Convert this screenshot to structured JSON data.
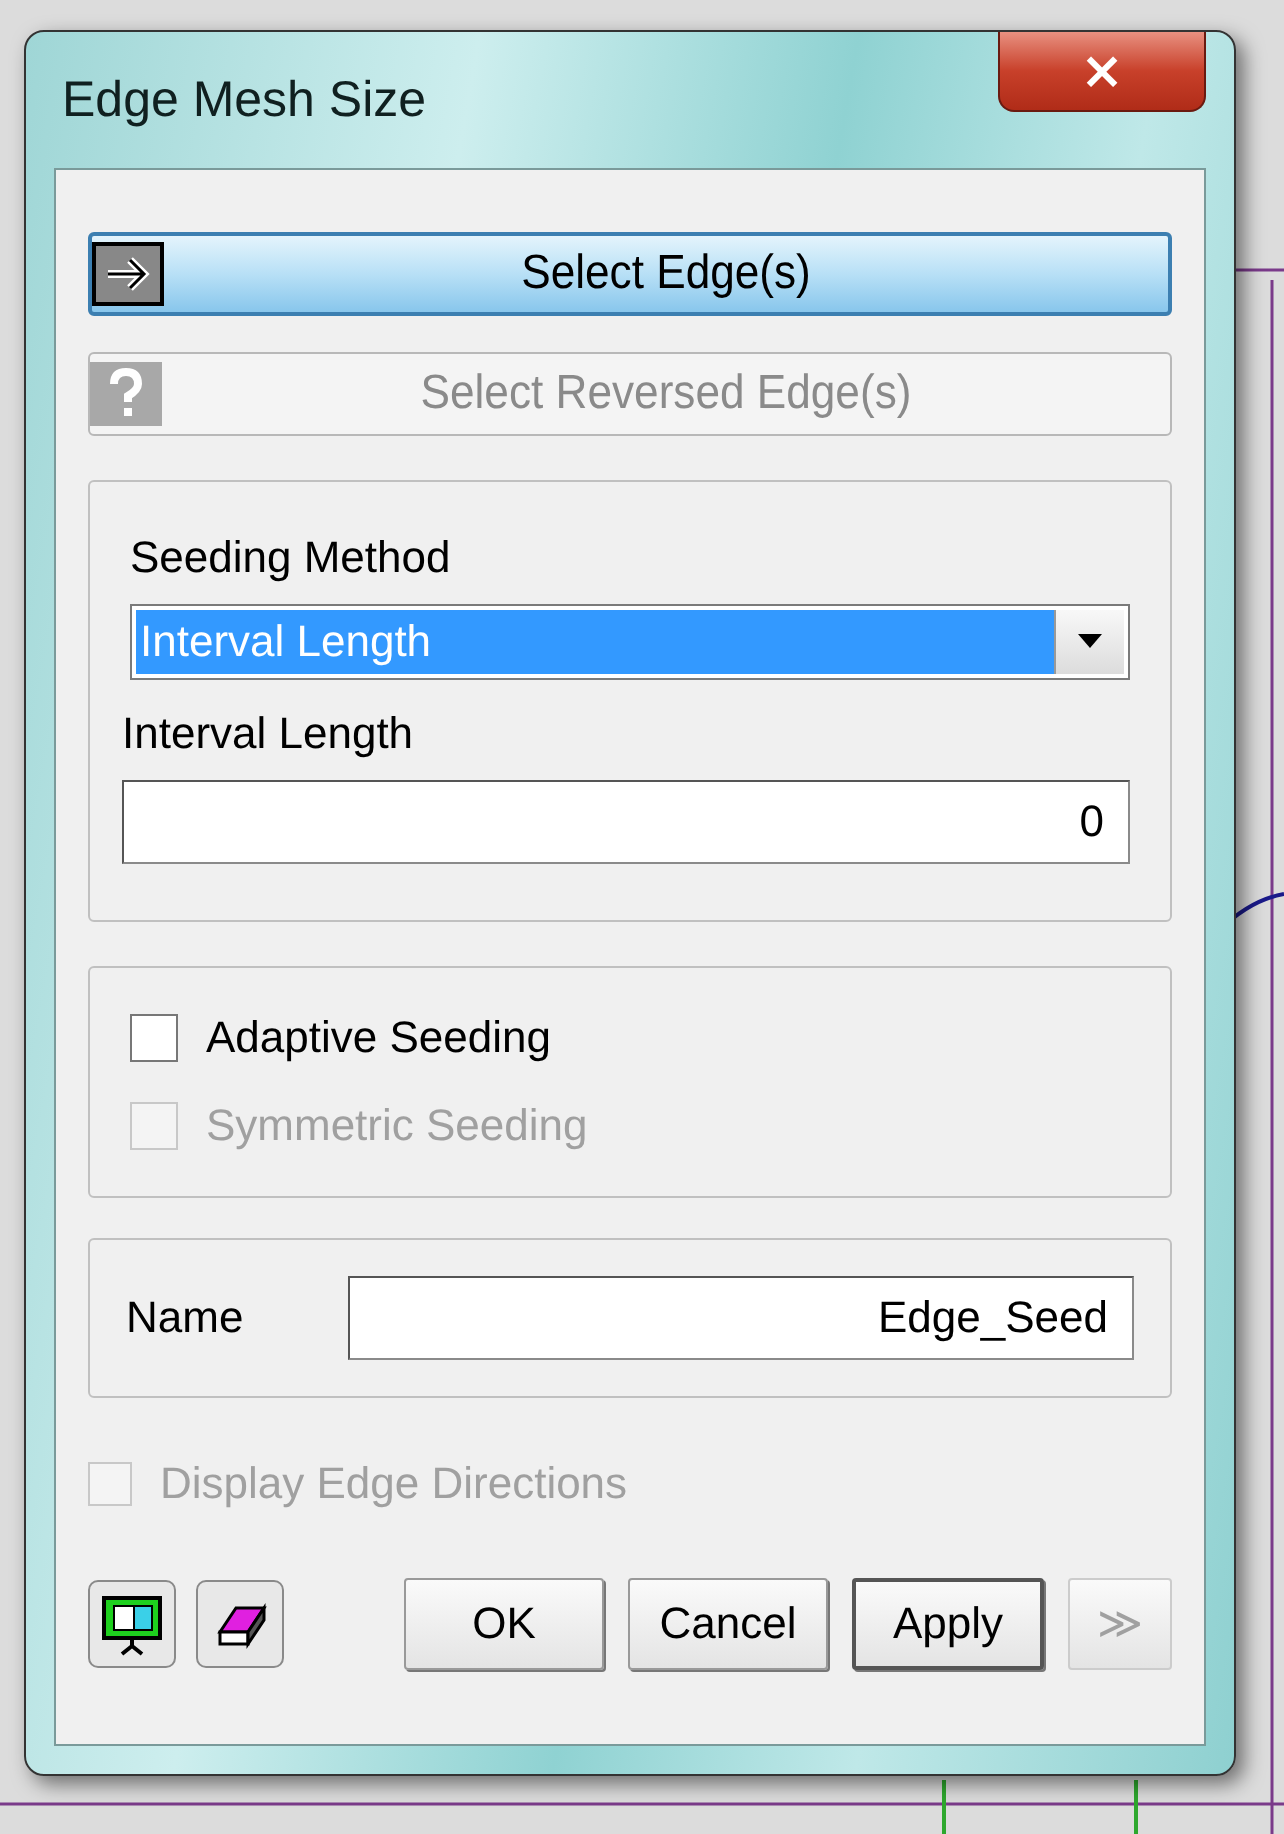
{
  "window": {
    "title": "Edge Mesh Size",
    "close": "×"
  },
  "select_buttons": [
    {
      "label": "Select Edge(s)",
      "selected": true,
      "disabled": false
    },
    {
      "label": "Select Reversed Edge(s)",
      "selected": false,
      "disabled": true
    }
  ],
  "seeding": {
    "method_label": "Seeding Method",
    "method_value": "Interval Length",
    "length_label": "Interval Length",
    "length_value": "0"
  },
  "options": [
    {
      "label": "Adaptive Seeding",
      "checked": false,
      "disabled": false
    },
    {
      "label": "Symmetric Seeding",
      "checked": false,
      "disabled": true
    }
  ],
  "name": {
    "label": "Name",
    "value": "Edge_Seed"
  },
  "display_directions": {
    "label": "Display Edge Directions",
    "checked": false,
    "disabled": true
  },
  "buttons": [
    {
      "label": "OK",
      "default": false,
      "disabled": false
    },
    {
      "label": "Cancel",
      "default": false,
      "disabled": false
    },
    {
      "label": "Apply",
      "default": true,
      "disabled": false
    },
    {
      "label": "≫",
      "default": false,
      "disabled": true
    }
  ]
}
